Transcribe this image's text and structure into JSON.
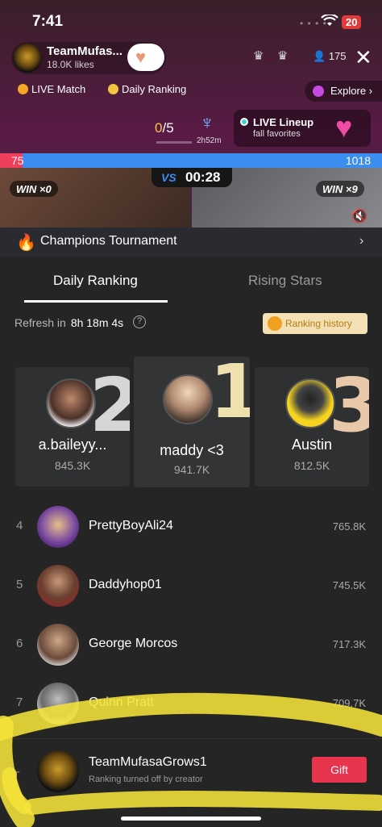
{
  "status": {
    "time": "7:41",
    "battery": "20"
  },
  "host": {
    "name": "TeamMufas...",
    "likes": "18.0K likes"
  },
  "viewers": {
    "count": "175"
  },
  "chips": {
    "live_match": "LIVE Match",
    "daily_ranking": "Daily Ranking",
    "explore": "Explore"
  },
  "match": {
    "score_a": "0",
    "score_b": "/5",
    "time_left": "2h52m"
  },
  "lineup": {
    "title": "LIVE Lineup",
    "subtitle": "fall favorites"
  },
  "battle": {
    "left_score": "75",
    "right_score": "1018",
    "left_share": 0.06,
    "timer": "00:28",
    "vs": "VS",
    "left_win": "WIN ×0",
    "right_win": "WIN ×9"
  },
  "tournament": {
    "title": "Champions Tournament"
  },
  "tabs": [
    {
      "label": "Daily Ranking",
      "active": true
    },
    {
      "label": "Rising Stars",
      "active": false
    }
  ],
  "refresh": {
    "label": "Refresh in",
    "countdown": "8h 18m 4s"
  },
  "history_label": "Ranking history",
  "podium": [
    {
      "rank": "2",
      "name": "a.baileyy...",
      "score": "845.3K"
    },
    {
      "rank": "1",
      "name": "maddy <3",
      "score": "941.7K"
    },
    {
      "rank": "3",
      "name": "Austin",
      "score": "812.5K"
    }
  ],
  "rows": [
    {
      "rank": "4",
      "name": "PrettyBoyAli24",
      "score": "765.8K"
    },
    {
      "rank": "5",
      "name": "Daddyhop01",
      "score": "745.5K"
    },
    {
      "rank": "6",
      "name": "George Morcos",
      "score": "717.3K"
    },
    {
      "rank": "7",
      "name": "Quinn Pratt",
      "score": "709.7K"
    }
  ],
  "me": {
    "rank": "-",
    "name": "TeamMufasaGrows1",
    "subtitle": "Ranking turned off by creator",
    "gift_label": "Gift"
  },
  "colors": {
    "accent_red": "#e8344c",
    "battle_blue": "#3b8ef0",
    "battle_red": "#ef3f5d",
    "gold": "#f5c542",
    "highlight": "#f5e23a"
  },
  "icons": [
    "wifi-icon",
    "heart-plus-icon",
    "crown-icon",
    "user-icon",
    "close-icon",
    "fire-icon",
    "chevron-right-icon",
    "info-icon",
    "trophy-icon",
    "mute-icon",
    "jellyfish-icon",
    "heart-icon"
  ]
}
